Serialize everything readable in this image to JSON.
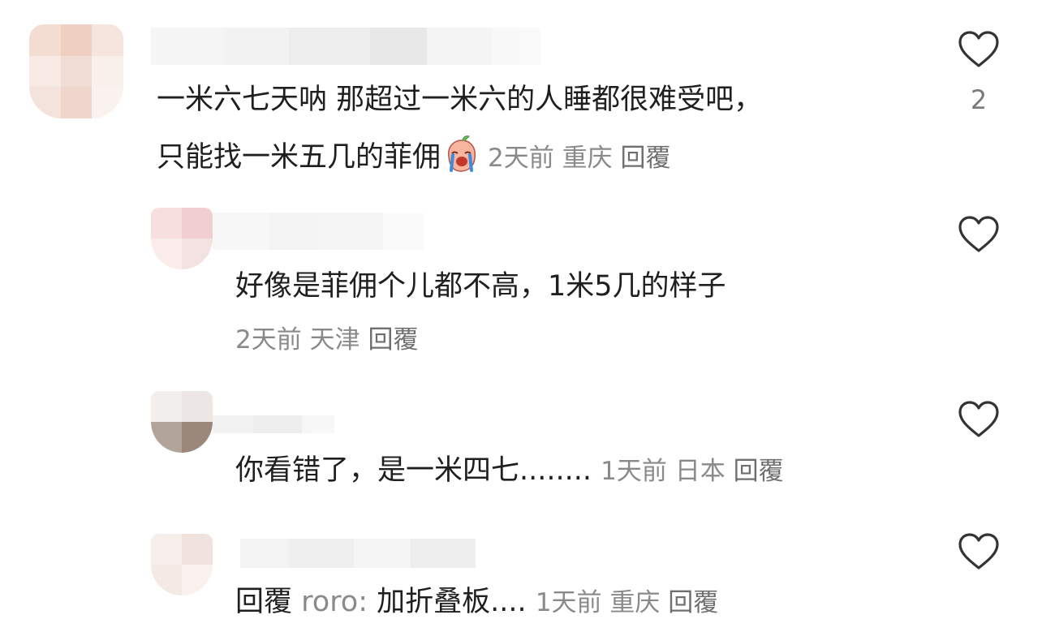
{
  "comments": [
    {
      "text_line1": "一米六七天呐 那超过一米六的人睡都很难受吧，",
      "text_line2": "只能找一米五几的菲佣",
      "emoji": "loudly-crying-face-icon",
      "time": "2天前",
      "location": "重庆",
      "reply_label": "回覆",
      "like_count": "2"
    },
    {
      "text": "好像是菲佣个儿都不高，1米5几的样子",
      "time": "2天前",
      "location": "天津",
      "reply_label": "回覆"
    },
    {
      "text": "你看错了，是一米四七........",
      "time": "1天前",
      "location": "日本",
      "reply_label": "回覆"
    },
    {
      "reply_prefix": "回覆",
      "reply_to": "roro:",
      "text": "加折叠板....",
      "time": "1天前",
      "location": "重庆",
      "reply_label": "回覆"
    }
  ],
  "colors": {
    "text": "#1f1f1f",
    "meta": "#8a8a8a",
    "icon": "#333333"
  }
}
